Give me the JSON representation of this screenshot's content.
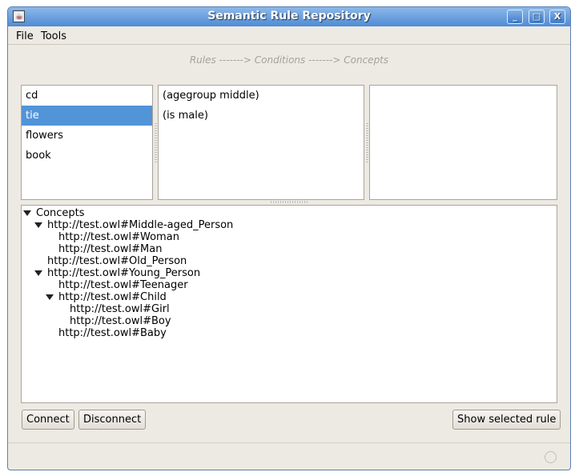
{
  "window": {
    "title": "Semantic Rule Repository",
    "controls": [
      "minimize",
      "maximize",
      "close"
    ]
  },
  "menu": {
    "items": [
      "File",
      "Tools"
    ]
  },
  "breadcrumb": "Rules -------> Conditions -------> Concepts",
  "rules": {
    "items": [
      "cd",
      "tie",
      "flowers",
      "book"
    ],
    "selected": "tie"
  },
  "conditions": {
    "items": [
      "(agegroup middle)",
      "(is male)"
    ]
  },
  "concepts_list": {
    "items": []
  },
  "tree": {
    "nodes": [
      {
        "label": "Concepts",
        "level": 0,
        "expanded": true
      },
      {
        "label": "http://test.owl#Middle-aged_Person",
        "level": 1,
        "expanded": true
      },
      {
        "label": "http://test.owl#Woman",
        "level": 2
      },
      {
        "label": "http://test.owl#Man",
        "level": 2
      },
      {
        "label": "http://test.owl#Old_Person",
        "level": 1
      },
      {
        "label": "http://test.owl#Young_Person",
        "level": 1,
        "expanded": true
      },
      {
        "label": "http://test.owl#Teenager",
        "level": 2
      },
      {
        "label": "http://test.owl#Child",
        "level": 2,
        "expanded": true
      },
      {
        "label": "http://test.owl#Girl",
        "level": 3
      },
      {
        "label": "http://test.owl#Boy",
        "level": 3
      },
      {
        "label": "http://test.owl#Baby",
        "level": 2
      }
    ]
  },
  "buttons": {
    "connect": "Connect",
    "disconnect": "Disconnect",
    "show": "Show selected rule"
  },
  "colors": {
    "selection": "#5294d8",
    "titlebar": "#4f8bd4"
  }
}
